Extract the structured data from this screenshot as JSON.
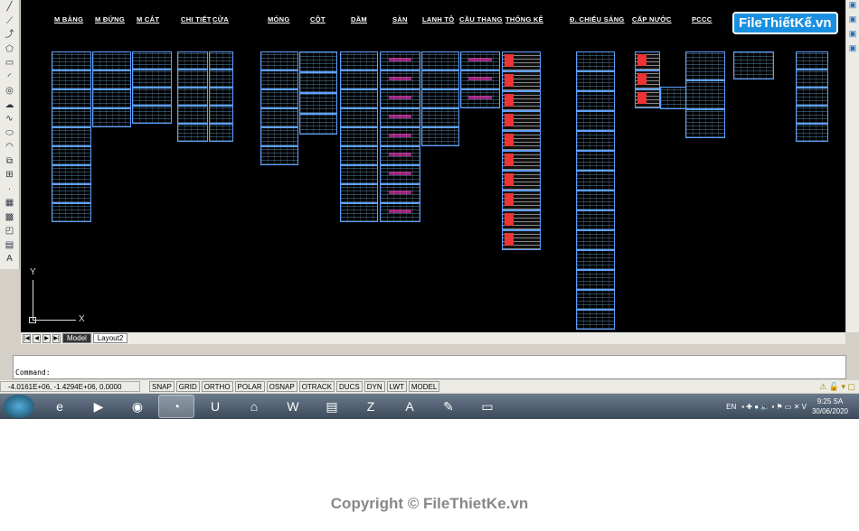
{
  "drawing": {
    "labels": [
      "M BẰNG",
      "M ĐỨNG",
      "M CẮT",
      "CHI TIẾT",
      "CỬA",
      "MÓNG",
      "CỘT",
      "DẦM",
      "SÀN",
      "LANH TÔ",
      "CẦU THANG",
      "THỐNG KÊ",
      "Đ. CHIẾU SÁNG",
      "CẤP NƯỚC",
      "PCCC"
    ],
    "ucs": {
      "y": "Y",
      "x": "X"
    }
  },
  "logo": "FileThiếtKế.vn",
  "tabs": {
    "nav": [
      "|◀",
      "◀",
      "▶",
      "▶|"
    ],
    "items": [
      "Model",
      "Layout2"
    ]
  },
  "command": {
    "prompt": "Command:"
  },
  "status": {
    "coords": "-4.0161E+06, -1.4294E+06, 0.0000",
    "toggles": [
      "SNAP",
      "GRID",
      "ORTHO",
      "POLAR",
      "OSNAP",
      "OTRACK",
      "DUCS",
      "DYN",
      "LWT",
      "MODEL"
    ]
  },
  "taskbar": {
    "apps": [
      "start",
      "internet-explorer",
      "media-player",
      "chrome",
      "coccoc",
      "unikey",
      "app-a",
      "word",
      "file-explorer",
      "zalo",
      "autocad",
      "paint",
      "photos"
    ],
    "lang": "EN",
    "time": "9:25 SA",
    "date": "30/06/2020"
  },
  "copyright": "Copyright © FileThietKe.vn"
}
